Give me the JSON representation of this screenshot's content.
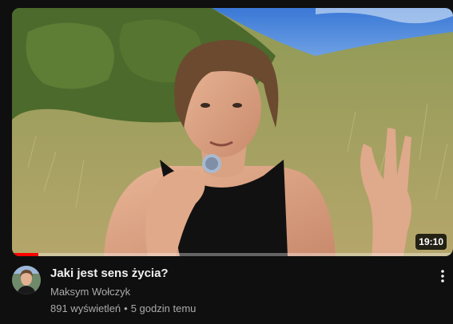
{
  "video": {
    "title": "Jaki jest sens życia?",
    "channel": "Maksym Wołczyk",
    "views": "891 wyświetleń",
    "separator": "•",
    "age": "5 godzin temu",
    "duration": "19:10",
    "watched_fraction": 0.06
  },
  "icons": {
    "more": "more-vertical-icon"
  },
  "colors": {
    "background": "#0f0f0f",
    "progress": "#ff0000",
    "secondary_text": "#aaaaaa"
  }
}
